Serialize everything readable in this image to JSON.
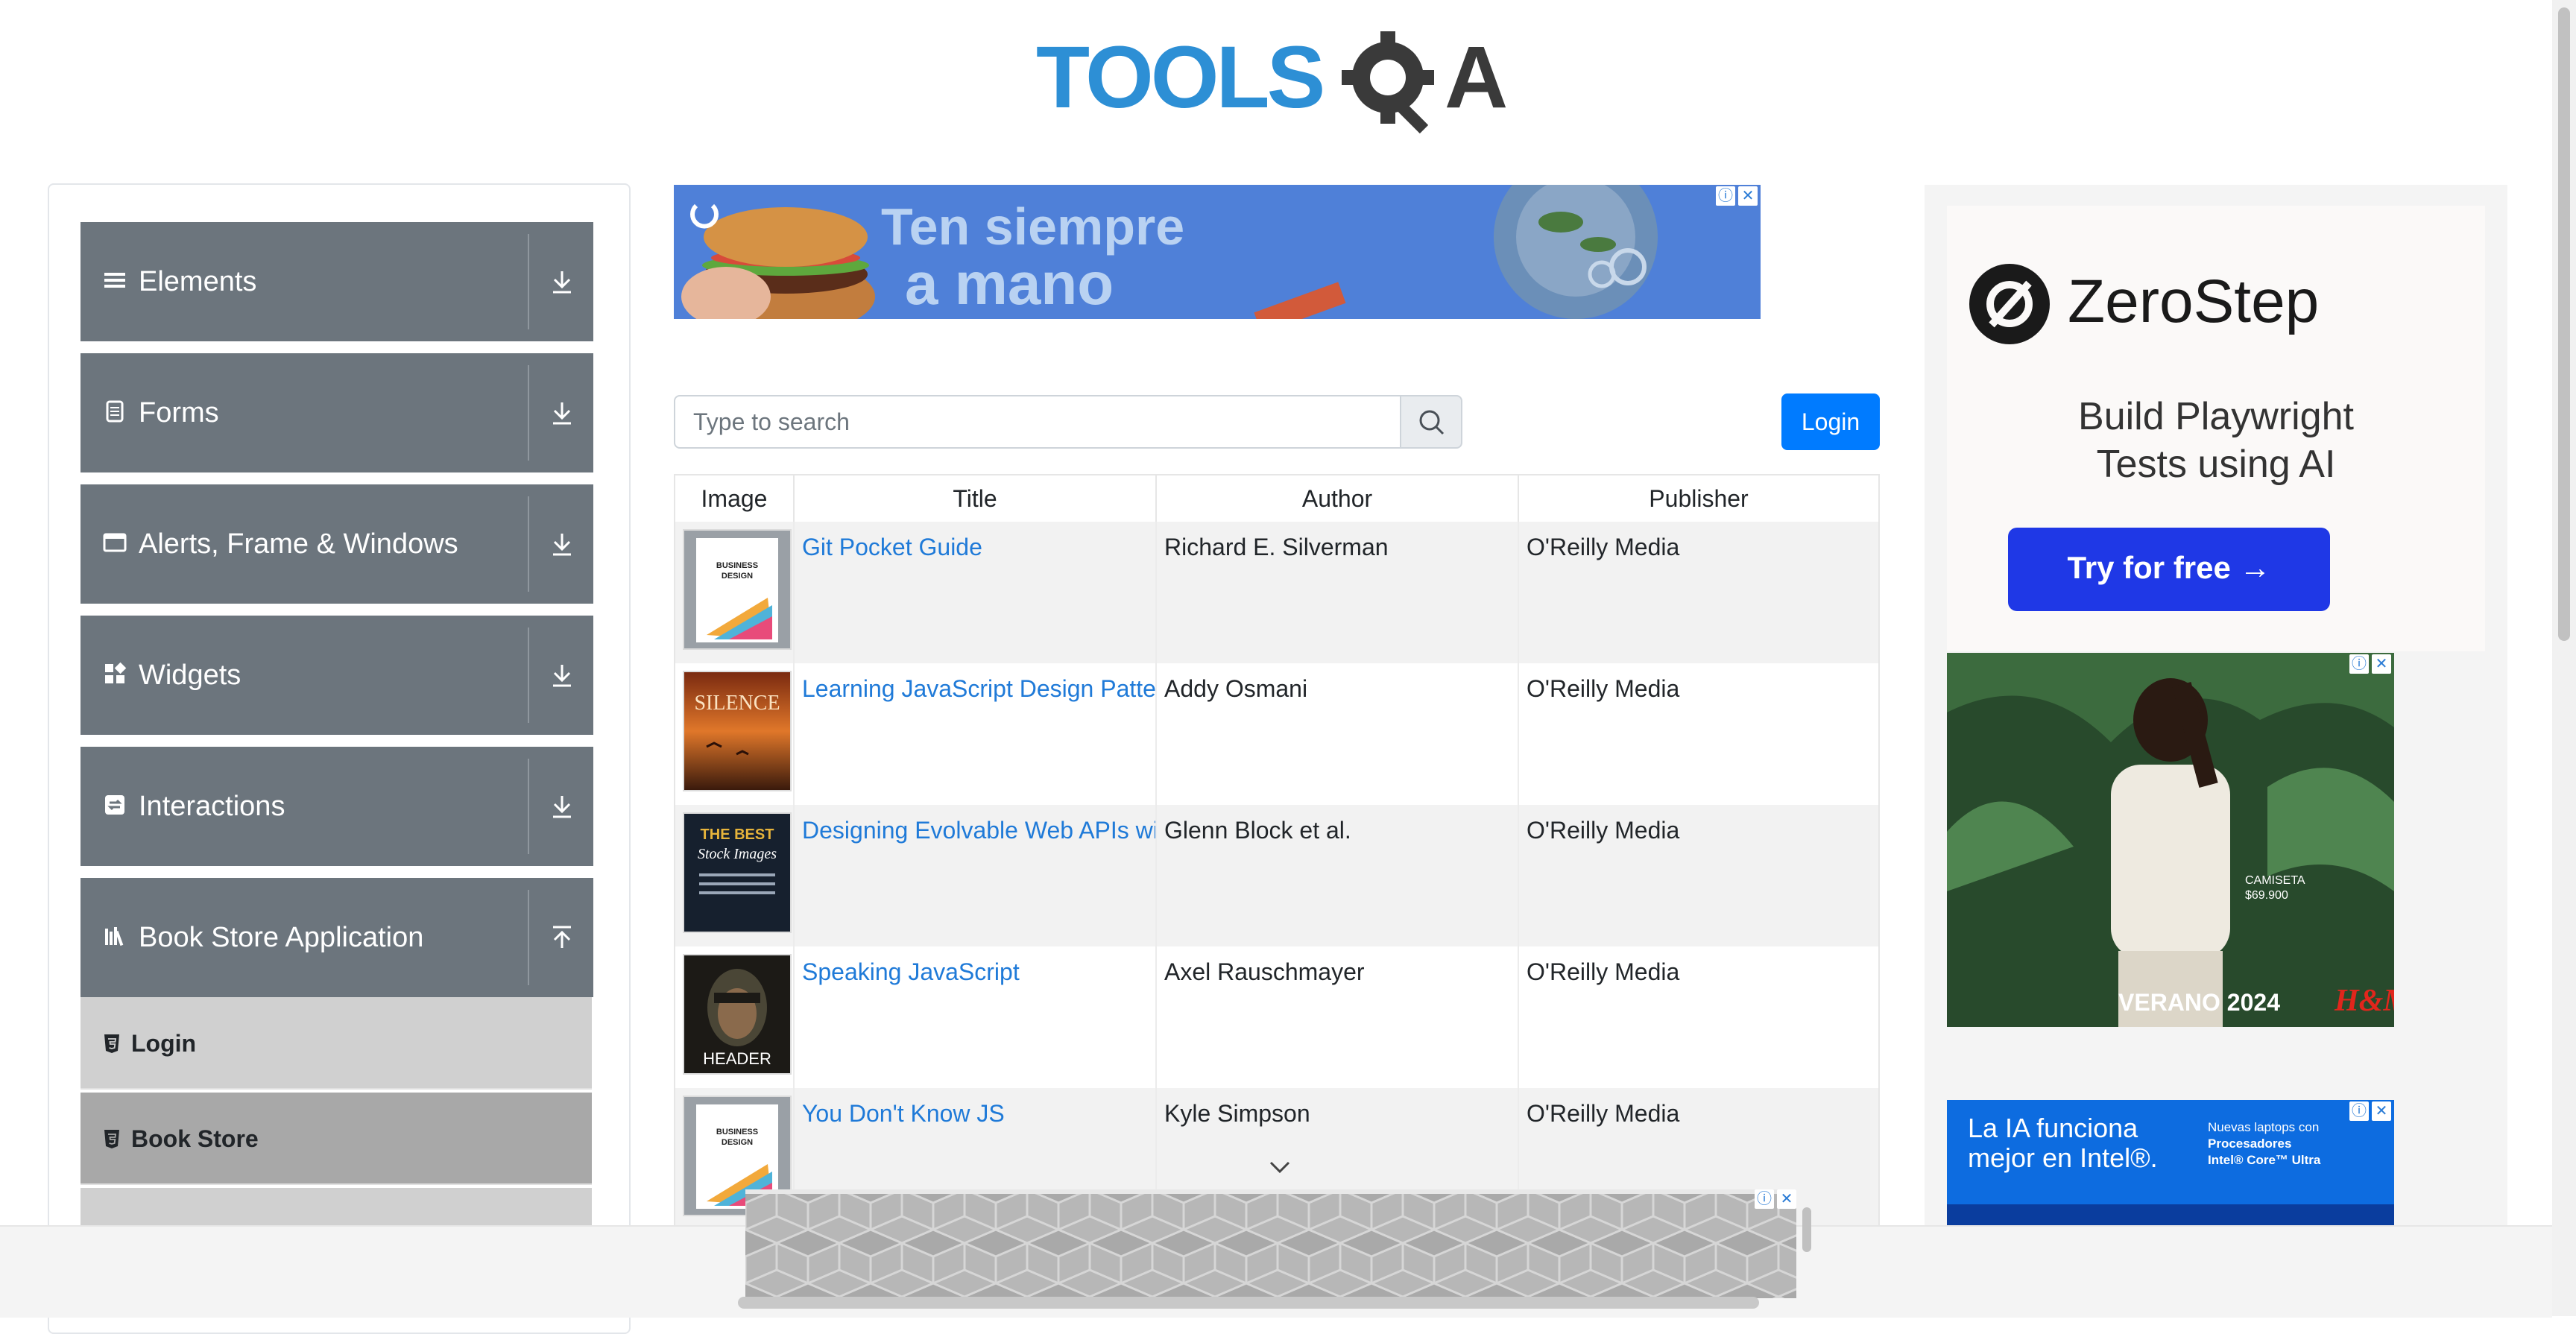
{
  "header": {
    "logo_text": "TOOLSQA"
  },
  "sidebar": {
    "groups": [
      {
        "label": "Elements",
        "icon": "hamburger-icon",
        "expanded": false
      },
      {
        "label": "Forms",
        "icon": "document-icon",
        "expanded": false
      },
      {
        "label": "Alerts, Frame & Windows",
        "icon": "window-icon",
        "expanded": false
      },
      {
        "label": "Widgets",
        "icon": "widgets-icon",
        "expanded": false
      },
      {
        "label": "Interactions",
        "icon": "interactions-icon",
        "expanded": false
      },
      {
        "label": "Book Store Application",
        "icon": "books-icon",
        "expanded": true
      }
    ],
    "book_store_items": [
      {
        "label": "Login",
        "icon": "html5-icon",
        "active": false
      },
      {
        "label": "Book Store",
        "icon": "html5-icon",
        "active": true
      }
    ]
  },
  "ads": {
    "top_banner": {
      "line1": "Ten siempre",
      "line2": "a mano"
    },
    "zerostep": {
      "brand": "ZeroStep",
      "headline_line1": "Build Playwright",
      "headline_line2": "Tests using AI",
      "cta": "Try for free →"
    },
    "hm": {
      "price_label": "CAMISETA",
      "price": "$69.900",
      "tagline": "VERANO 2024",
      "brand": "H&M"
    },
    "intel": {
      "line1": "La IA funciona",
      "line2": "mejor en Intel®.",
      "side1": "Nuevas laptops con",
      "side2": "Procesadores",
      "side3": "Intel® Core™ Ultra"
    }
  },
  "search": {
    "placeholder": "Type to search"
  },
  "login_button": "Login",
  "table": {
    "columns": [
      "Image",
      "Title",
      "Author",
      "Publisher"
    ],
    "rows": [
      {
        "title": "Git Pocket Guide",
        "author": "Richard E. Silverman",
        "publisher": "O'Reilly Media",
        "cover": "business-design"
      },
      {
        "title": "Learning JavaScript Design Patte",
        "author": "Addy Osmani",
        "publisher": "O'Reilly Media",
        "cover": "silence"
      },
      {
        "title": "Designing Evolvable Web APIs wi",
        "author": "Glenn Block et al.",
        "publisher": "O'Reilly Media",
        "cover": "the-best"
      },
      {
        "title": "Speaking JavaScript",
        "author": "Axel Rauschmayer",
        "publisher": "O'Reilly Media",
        "cover": "header"
      },
      {
        "title": "You Don't Know JS",
        "author": "Kyle Simpson",
        "publisher": "O'Reilly Media",
        "cover": "business-design"
      }
    ]
  },
  "colors": {
    "sidebar_header_bg": "#6c757d",
    "active_item_bg": "#a8a8a8",
    "inactive_item_bg": "#d0d0d0",
    "link": "#1f7ad8",
    "primary": "#007bff"
  }
}
